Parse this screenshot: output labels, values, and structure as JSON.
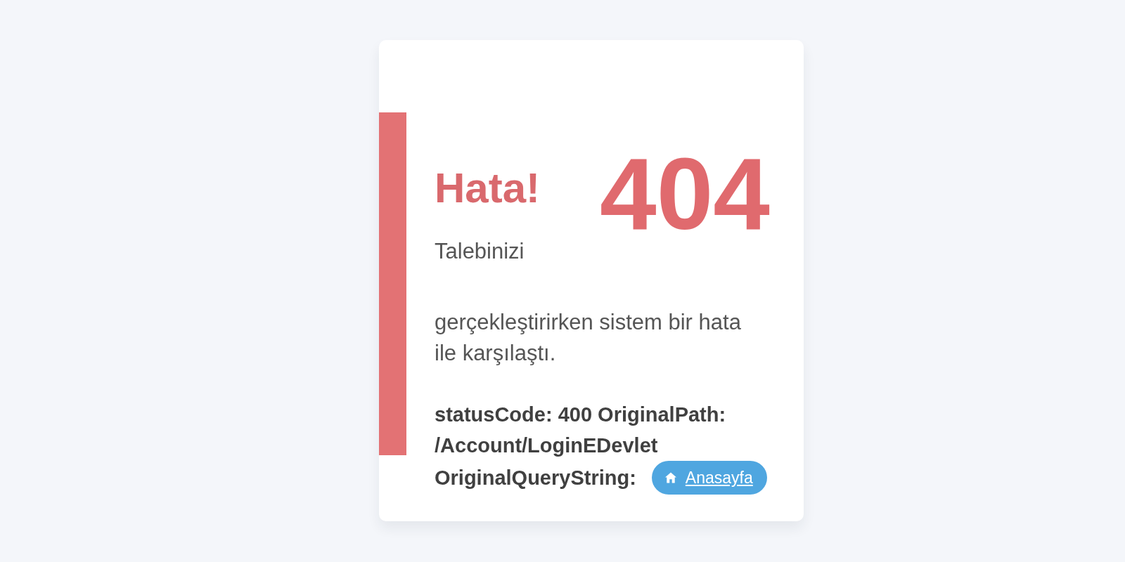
{
  "card": {
    "title": "Hata!",
    "code": "404",
    "message": [
      "Talebinizi",
      "gerçekleştirirken sistem bir hata ile karşılaştı."
    ],
    "details": [
      "statusCode: 400 OriginalPath:",
      "/Account/LoginEDevlet",
      "OriginalQueryString:"
    ],
    "home_button": {
      "label": "Anasayfa"
    }
  }
}
